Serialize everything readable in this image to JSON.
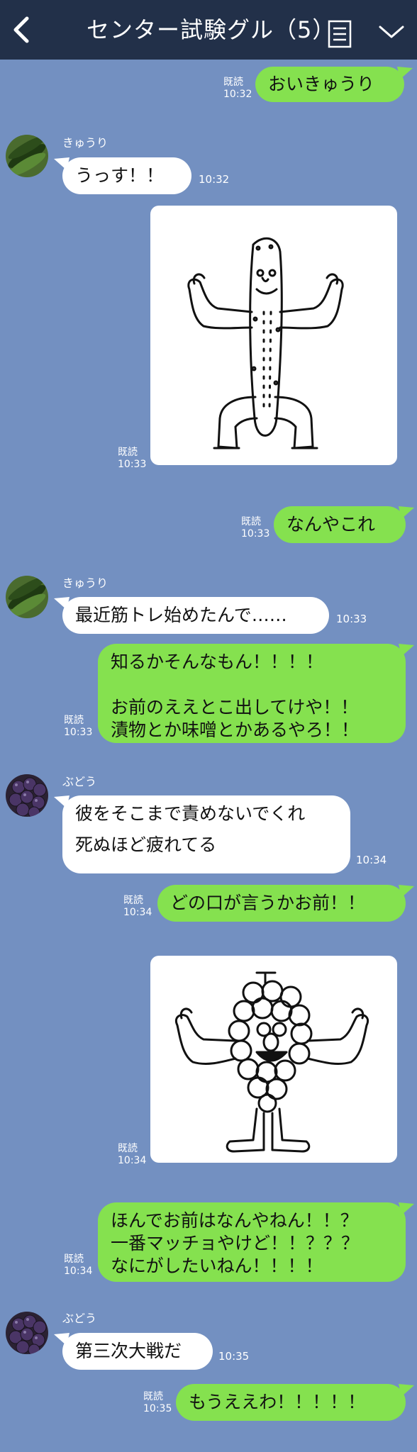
{
  "header": {
    "title": "センター試験グル（5）",
    "back_icon": "chevron-left-icon",
    "note_icon": "notes-icon",
    "menu_icon": "chevron-down-icon"
  },
  "colors": {
    "background": "#7390c1",
    "header": "#223049",
    "sent_bubble": "#85e14f",
    "received_bubble": "#ffffff"
  },
  "messages": [
    {
      "side": "sent",
      "read": "既読",
      "time": "10:32",
      "lines": [
        "おいきゅうり"
      ]
    },
    {
      "side": "received",
      "sender": "きゅうり",
      "time": "10:32",
      "lines": [
        "うっす！！"
      ]
    },
    {
      "side": "received",
      "type": "image",
      "read": "既読",
      "time": "10:33",
      "image": "muscular-cucumber-drawing"
    },
    {
      "side": "sent",
      "read": "既読",
      "time": "10:33",
      "lines": [
        "なんやこれ"
      ]
    },
    {
      "side": "received",
      "sender": "きゅうり",
      "time": "10:33",
      "lines": [
        "最近筋トレ始めたんで……"
      ]
    },
    {
      "side": "sent",
      "read": "既読",
      "time": "10:33",
      "lines": [
        "知るかそんなもん！！！！",
        "",
        "お前のええとこ出してけや！！",
        "漬物とか味噌とかあるやろ！！"
      ]
    },
    {
      "side": "received",
      "sender": "ぶどう",
      "time": "10:34",
      "lines": [
        "彼をそこまで責めないでくれ",
        "",
        "死ぬほど疲れてる"
      ]
    },
    {
      "side": "sent",
      "read": "既読",
      "time": "10:34",
      "lines": [
        "どの口が言うかお前！！"
      ]
    },
    {
      "side": "received",
      "type": "image",
      "read": "既読",
      "time": "10:34",
      "image": "muscular-grape-drawing"
    },
    {
      "side": "sent",
      "read": "既読",
      "time": "10:34",
      "lines": [
        "ほんでお前はなんやねん！！？",
        "一番マッチョやけど！！？？？",
        "なにがしたいねん！！！！"
      ]
    },
    {
      "side": "received",
      "sender": "ぶどう",
      "time": "10:35",
      "lines": [
        "第三次大戦だ"
      ]
    },
    {
      "side": "sent",
      "read": "既読",
      "time": "10:35",
      "lines": [
        "もうええわ！！！！！"
      ]
    }
  ]
}
